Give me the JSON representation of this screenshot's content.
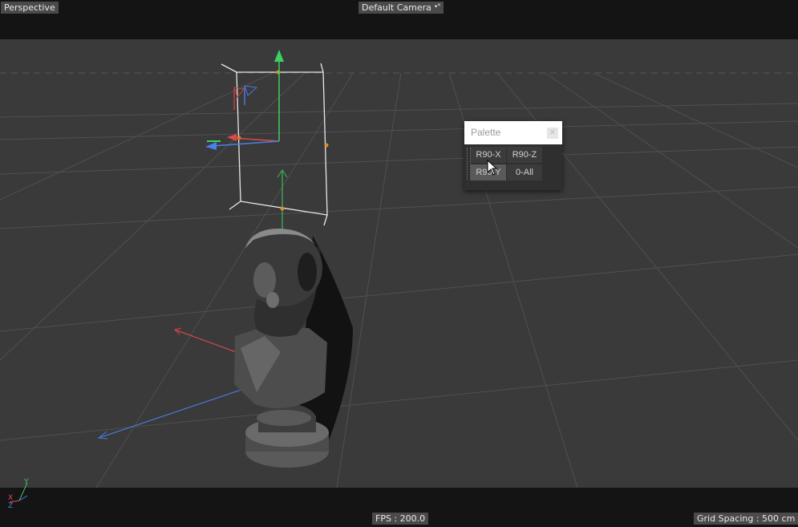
{
  "viewport": {
    "view_label": "Perspective",
    "camera_label": "Default Camera",
    "camera_icon": "camera-target-icon",
    "background_color": "#3a3a3a"
  },
  "status": {
    "fps": "FPS : 200.0",
    "grid_spacing": "Grid Spacing : 500 cm"
  },
  "palette": {
    "title": "Palette",
    "close_icon": "close-icon",
    "buttons": [
      "R90-X",
      "R90-Z",
      "R90-Y",
      "0-All"
    ]
  },
  "axis_indicator": {
    "x": "X",
    "y": "Y",
    "z": "Z",
    "colors": {
      "x": "#e05050",
      "y": "#40c060",
      "z": "#4f7fe0"
    }
  }
}
